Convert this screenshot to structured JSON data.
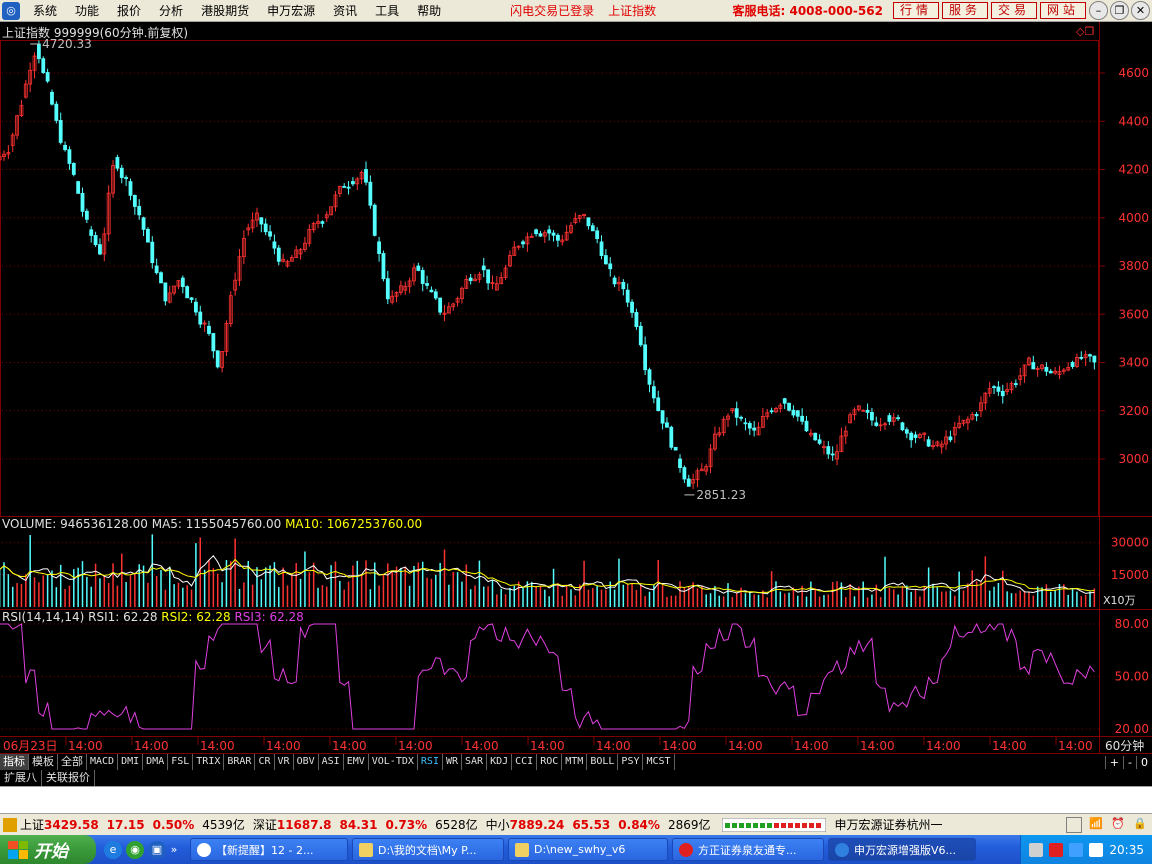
{
  "menubar": {
    "items": [
      "系统",
      "功能",
      "报价",
      "分析",
      "港股期货",
      "申万宏源",
      "资讯",
      "工具",
      "帮助"
    ],
    "status": "闪电交易已登录",
    "index_name": "上证指数",
    "hotline": "客服电话: 4008-000-562",
    "buttons": [
      "行情",
      "服务",
      "交易",
      "网站"
    ]
  },
  "main_panel": {
    "title": "上证指数 999999(60分钟.前复权)",
    "high_label": "4720.33",
    "low_label": "2851.23",
    "y_ticks": [
      "4600",
      "4400",
      "4200",
      "4000",
      "3800",
      "3600",
      "3400",
      "3200",
      "3000"
    ]
  },
  "volume_panel": {
    "label_volume": "VOLUME: 946536128.00",
    "label_ma5": "MA5: 1155045760.00",
    "label_ma10": "MA10: 1067253760.00",
    "y_ticks": [
      "30000",
      "15000"
    ],
    "unit": "X10万"
  },
  "rsi_panel": {
    "label_params": "RSI(14,14,14)",
    "label_rsi1": "RSI1: 62.28",
    "label_rsi2": "RSI2: 62.28",
    "label_rsi3": "RSI3: 62.28",
    "y_ticks": [
      "80.00",
      "50.00",
      "20.00"
    ]
  },
  "x_axis": {
    "first_label": "06月23日",
    "labels": [
      "14:00",
      "14:00",
      "14:00",
      "14:00",
      "14:00",
      "14:00",
      "14:00",
      "14:00",
      "14:00",
      "14:00",
      "14:00",
      "14:00",
      "14:00",
      "14:00",
      "14:00",
      "14:00"
    ],
    "period": "60分钟"
  },
  "chart_data": {
    "type": "candlestick",
    "title": "上证指数 999999(60分钟.前复权)",
    "y_range": [
      2851.23,
      4720.33
    ],
    "close_series": [
      4300,
      4500,
      4720,
      4520,
      4300,
      4150,
      3950,
      3850,
      4250,
      4150,
      4000,
      3800,
      3650,
      3750,
      3650,
      3550,
      3380,
      3700,
      3950,
      4000,
      3900,
      3800,
      3850,
      3950,
      4000,
      4100,
      4150,
      4200,
      3900,
      3650,
      3700,
      3800,
      3700,
      3600,
      3650,
      3750,
      3800,
      3700,
      3800,
      3900,
      3950,
      3950,
      3900,
      3980,
      4000,
      3900,
      3750,
      3700,
      3550,
      3300,
      3150,
      3000,
      2900,
      2950,
      3100,
      3200,
      3150,
      3100,
      3200,
      3250,
      3200,
      3100,
      3050,
      3000,
      3150,
      3200,
      3150,
      3180,
      3150,
      3100,
      3080,
      3050,
      3100,
      3150,
      3200,
      3300,
      3280,
      3330,
      3400,
      3380,
      3350,
      3400,
      3420,
      3380
    ]
  },
  "tabs": [
    "指标",
    "模板",
    "全部",
    "MACD",
    "DMI",
    "DMA",
    "FSL",
    "TRIX",
    "BRAR",
    "CR",
    "VR",
    "OBV",
    "ASI",
    "EMV",
    "VOL-TDX",
    "RSI",
    "WR",
    "SAR",
    "KDJ",
    "CCI",
    "ROC",
    "MTM",
    "BOLL",
    "PSY",
    "MCST"
  ],
  "tabs_right": [
    "+",
    "-",
    "0"
  ],
  "subtabs": [
    "扩展八",
    "关联报价"
  ],
  "ticker": {
    "sh_label": "上证",
    "sh_value": "3429.58",
    "sh_change": "17.15",
    "sh_pct": "0.50%",
    "sh_amount": "4539亿",
    "sz_label": "深证",
    "sz_value": "11687.8",
    "sz_change": "84.31",
    "sz_pct": "0.73%",
    "sz_amount": "6528亿",
    "zx_label": "中小",
    "zx_value": "7889.24",
    "zx_change": "65.53",
    "zx_pct": "0.84%",
    "zx_amount": "2869亿",
    "company": "申万宏源证券杭州一"
  },
  "taskbar": {
    "start": "开始",
    "tasks": [
      "【新提醒】12 - 2...",
      "D:\\我的文档\\My P...",
      "D:\\new_swhy_v6",
      "方正证券泉友通专...",
      "申万宏源增强版V6..."
    ],
    "clock": "20:35"
  },
  "colors": {
    "up": "#ff3232",
    "down": "#54ffff",
    "rsi": "#e040e0",
    "ma5": "#ffffff",
    "ma10": "#ffff00",
    "grid": "#800000"
  }
}
